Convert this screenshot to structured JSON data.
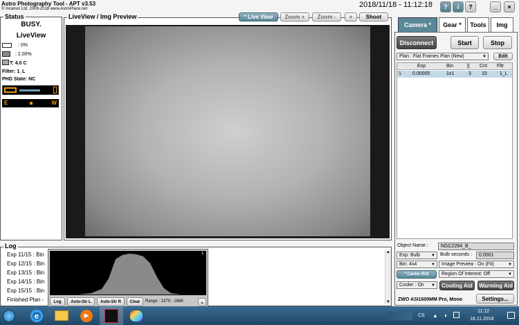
{
  "app": {
    "title": "Astro Photography Tool  -  APT v3.53",
    "copyright": "© Incanus Ltd. 2009-2018  www.AstroPlace.net",
    "datetime": "2018/11/18 - 11:12:18",
    "win_buttons": [
      "?",
      "i",
      "?",
      "_",
      "×"
    ]
  },
  "status": {
    "title": "Status",
    "state1": "BUSY.",
    "state2": "LiveView",
    "rows": [
      {
        "icon": "camera-icon",
        "value": ": 0%"
      },
      {
        "icon": "power-icon",
        "value": ": 2.00%"
      },
      {
        "icon": "thermometer-icon",
        "value": "T: 4.0 C"
      }
    ],
    "filter": "Filter: 1_L",
    "phd": "PHD State: NC",
    "compass": [
      "E",
      "W"
    ]
  },
  "preview": {
    "title": "LiveView / Img Preview",
    "buttons": {
      "live": "* Live View",
      "zoom_in": "Zoom +",
      "zoom_out": "Zoom -",
      "center": "+",
      "shoot": "Shoot"
    }
  },
  "tabs": [
    "Camera *",
    "Gear *",
    "Tools",
    "Img"
  ],
  "camera": {
    "disconnect": "Disconnect",
    "start": "Start",
    "stop": "Stop",
    "plan": "Plan : Flat Frames Plan (New)",
    "edit": "Edit",
    "table": {
      "headers": [
        "",
        "Exp",
        "Bin",
        "||",
        "Cnt",
        "Fltr"
      ],
      "rows": [
        [
          "1",
          "0.00005",
          "1x1",
          "3",
          "15",
          "1_L"
        ]
      ]
    },
    "object_label": "Object Name :",
    "object_value": "NGC2264_B_",
    "exp": "Exp: Bulb",
    "bulb_label": "Bulb seconds :",
    "bulb_value": "0.0001",
    "bin": "Bin: 4x4",
    "image_preview": "Image Preview : On (Fit)",
    "center_roi": "* Center ROI",
    "roi": "Region Of Interest: Off",
    "cooler": "Cooler : On",
    "cooling_aid": "Cooling Aid",
    "warming_aid": "Warming Aid",
    "camera_name": "ZWO ASI1600MM Pro, Mono",
    "settings": "Settings..."
  },
  "log": {
    "title": "Log",
    "lines": [
      "Exp 11/15 : Bin",
      "Exp 12/15 : Bin",
      "Exp 13/15 : Bin",
      "Exp 14/15 : Bin",
      "Exp 15/15 : Bin",
      "Finished Plan -"
    ]
  },
  "histogram": {
    "buttons": [
      "Log",
      "Auto-Str L",
      "Auto-Str R",
      "Clear"
    ],
    "range": "Range : 1379 - 1698",
    "corner": "L"
  },
  "taskbar": {
    "lang": "CS",
    "time": "11:12",
    "date": "18.11.2018"
  }
}
